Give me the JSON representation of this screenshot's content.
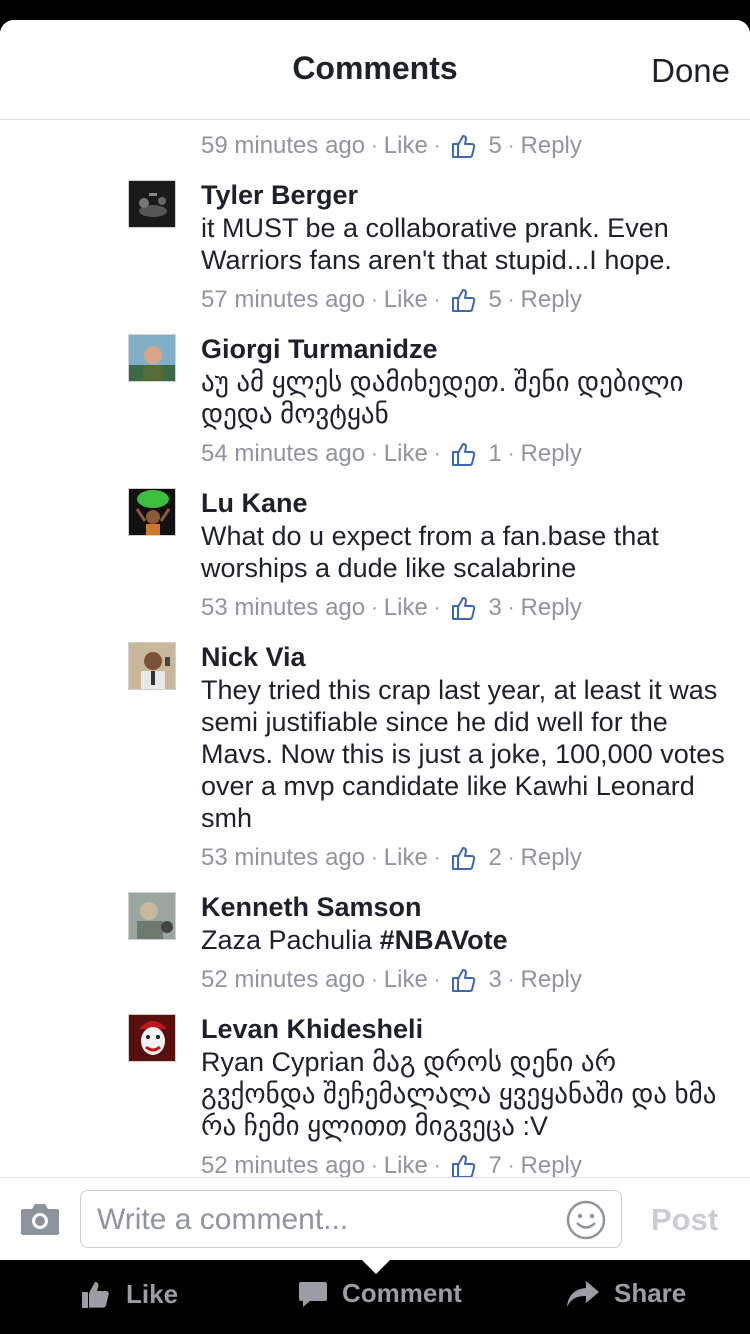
{
  "header": {
    "title": "Comments",
    "done_label": "Done"
  },
  "meta_labels": {
    "like": "Like",
    "reply": "Reply",
    "separator": "·"
  },
  "partial_top": {
    "time": "59 minutes ago",
    "likes": "5"
  },
  "comments": [
    {
      "name": "Tyler Berger",
      "text": "it MUST be a collaborative prank. Even Warriors fans aren't that stupid...I hope.",
      "time": "57 minutes ago",
      "likes": "5"
    },
    {
      "name": "Giorgi Turmanidze",
      "text": "აუ ამ ყლეს დამიხედეთ. შენი დებილი დედა მოვტყან",
      "time": "54 minutes ago",
      "likes": "1"
    },
    {
      "name": "Lu Kane",
      "text": "What do u expect from a fan.base that worships a dude like scalabrine",
      "time": "53 minutes ago",
      "likes": "3"
    },
    {
      "name": "Nick Via",
      "text": "They tried this crap last year, at least it was semi justifiable since he did well for the Mavs. Now this is just a joke, 100,000 votes over a mvp candidate like Kawhi Leonard smh",
      "time": "53 minutes ago",
      "likes": "2"
    },
    {
      "name": "Kenneth Samson",
      "text": "Zaza Pachulia ",
      "hashtag": "#NBAVote",
      "time": "52 minutes ago",
      "likes": "3"
    },
    {
      "name": "Levan Khidesheli",
      "text": "Ryan Cyprian მაგ დროს დენი არ გვქონდა შეჩემალალა ყვეყანაში და ხმა რა ჩემი ყლითთ მიგვეცა :V",
      "time": "52 minutes ago",
      "likes": "7"
    }
  ],
  "composer": {
    "placeholder": "Write a comment...",
    "post_label": "Post"
  },
  "bottom_bar": {
    "like": "Like",
    "comment": "Comment",
    "share": "Share"
  },
  "colors": {
    "text": "#1d2129",
    "meta": "#90949c",
    "like_blue": "#4267b2",
    "bar": "#000000"
  }
}
